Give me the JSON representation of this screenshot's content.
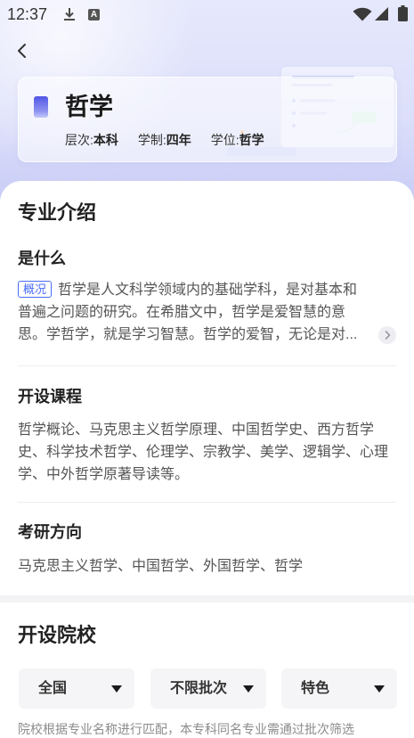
{
  "status_bar": {
    "time": "12:37",
    "notification_letter": "A",
    "icons": [
      "download-icon",
      "a-letter-icon",
      "wifi-icon",
      "signal-icon",
      "battery-icon"
    ]
  },
  "nav": {
    "back_icon": "back-arrow-icon"
  },
  "header": {
    "icon": "major-badge-icon",
    "title": "哲学",
    "meta": [
      {
        "label": "层次:",
        "value": "本科"
      },
      {
        "label": "学制:",
        "value": "四年"
      },
      {
        "label": "学位:",
        "value": "哲学"
      }
    ]
  },
  "intro": {
    "heading": "专业介绍",
    "what": {
      "heading": "是什么",
      "badge": "概况",
      "text": "哲学是人文科学领域内的基础学科，是对基本和普遍之问题的研究。在希腊文中，哲学是爱智慧的意思。学哲学，就是学习智慧。哲学的爱智，无论是对...",
      "more_icon": "chevron-right-icon"
    },
    "courses": {
      "heading": "开设课程",
      "text": "哲学概论、马克思主义哲学原理、中国哲学史、西方哲学史、科学技术哲学、伦理学、宗教学、美学、逻辑学、心理学、中外哲学原著导读等。"
    },
    "postgrad": {
      "heading": "考研方向",
      "text": "马克思主义哲学、中国哲学、外国哲学、哲学"
    }
  },
  "schools": {
    "heading": "开设院校",
    "filters": [
      {
        "label": "全国",
        "icon": "caret-down-icon"
      },
      {
        "label": "不限批次",
        "icon": "caret-down-icon"
      },
      {
        "label": "特色",
        "icon": "caret-down-icon"
      }
    ],
    "note": "院校根据专业名称进行匹配，本专科同名专业需通过批次筛选"
  },
  "colors": {
    "accent": "#4a6cf7",
    "heading_text": "#222222",
    "body_text": "#555555",
    "muted_text": "#8c8c8c",
    "filter_bg": "#f5f5f7",
    "header_bg_top": "#e6e8fc",
    "header_bg_bottom": "#c6caf5",
    "divider": "#eeeeee",
    "section_gap": "#f3f3f5"
  }
}
